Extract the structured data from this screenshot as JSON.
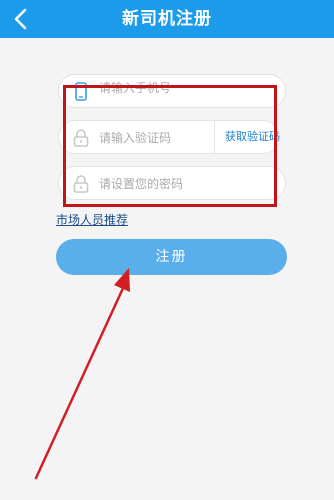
{
  "header": {
    "title": "新司机注册",
    "back_icon": "chevron-left-icon"
  },
  "form": {
    "phone_placeholder": "请输入手机号",
    "code_placeholder": "请输入验证码",
    "get_code_label": "获取验证码",
    "password_placeholder": "请设置您的密码"
  },
  "links": {
    "recommend_label": "市场人员推荐"
  },
  "buttons": {
    "register_label": "注册"
  },
  "colors": {
    "header": "#1b9be9",
    "button": "#5aaee9",
    "annotation": "#c0161b"
  }
}
